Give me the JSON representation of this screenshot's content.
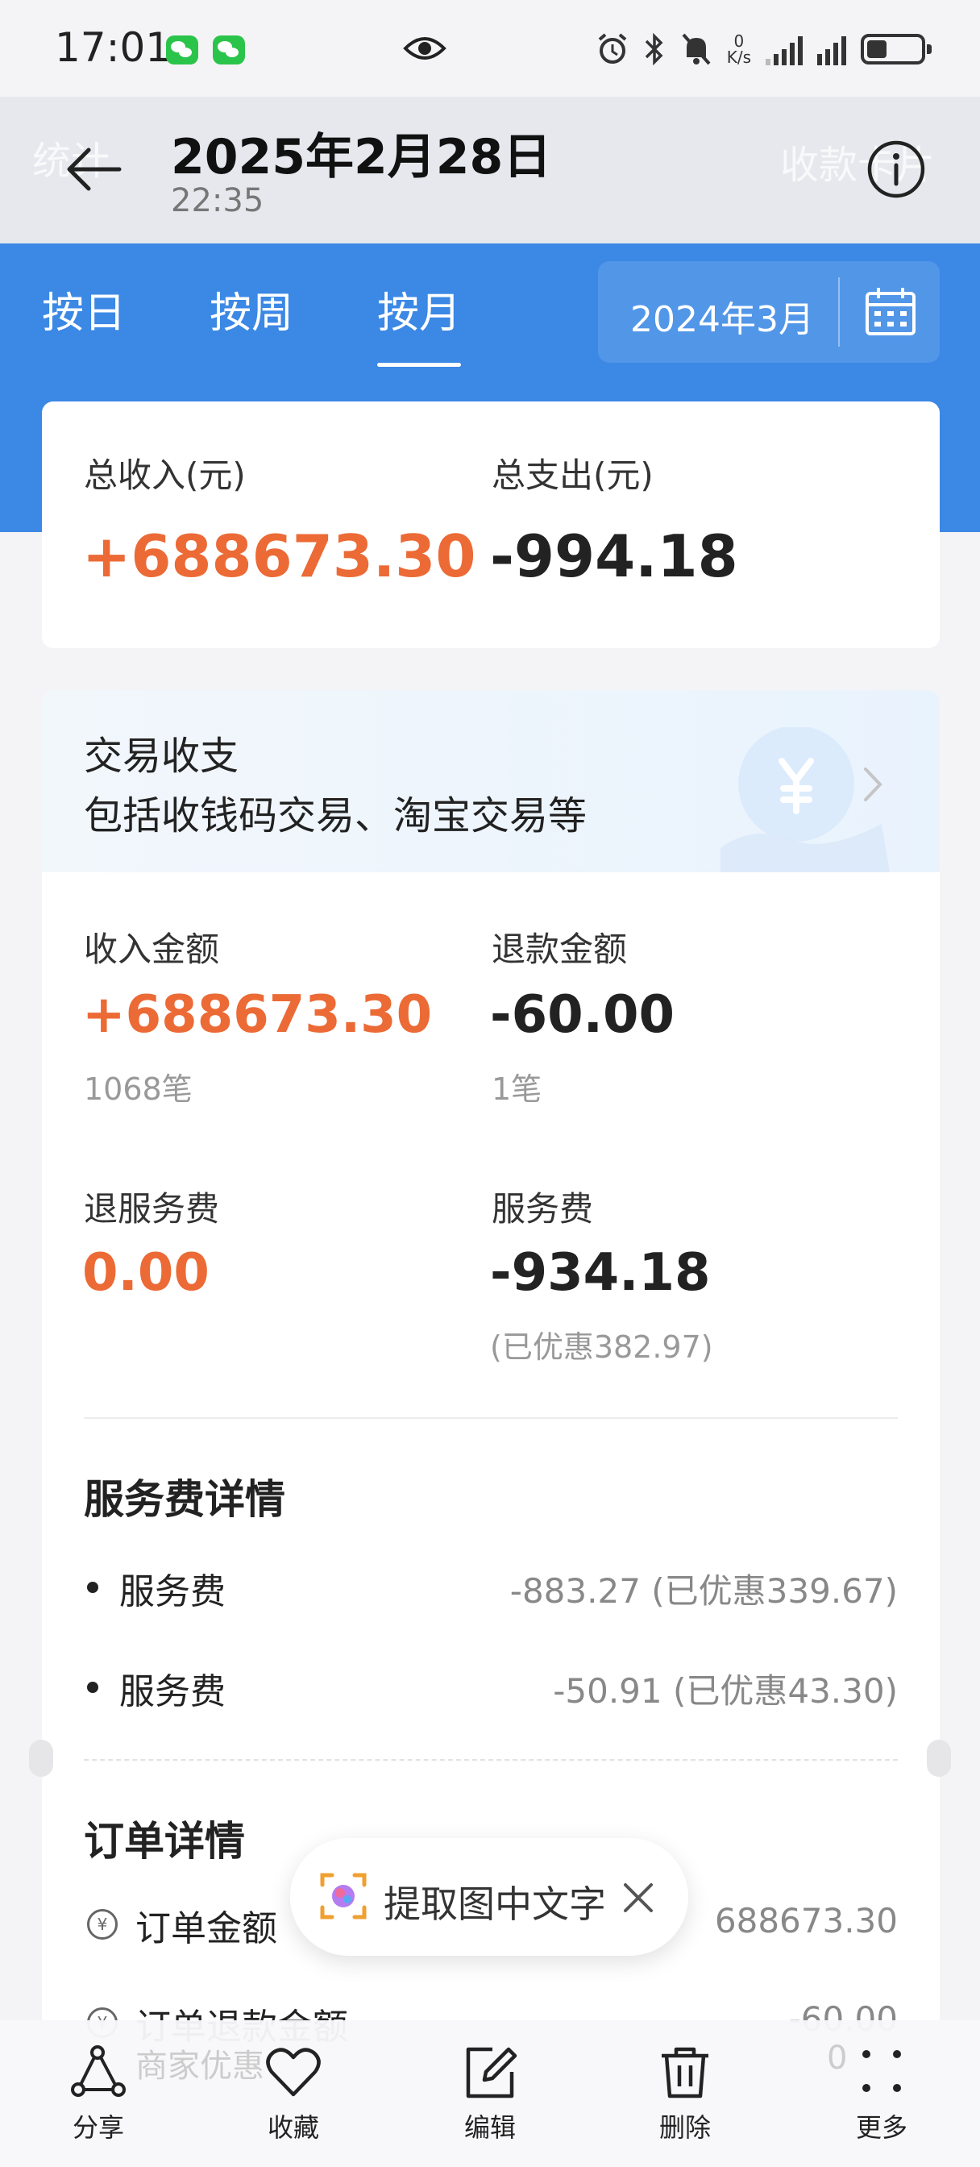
{
  "status_bar": {
    "time": "17:01",
    "net_speed_top": "0",
    "net_speed_bottom": "K/s"
  },
  "header": {
    "title": "2025年2月28日",
    "subtitle": "22:35",
    "ghost_left": "统计",
    "ghost_right": "收款卡片"
  },
  "tabs": [
    {
      "label": "按日",
      "active": false
    },
    {
      "label": "按周",
      "active": false
    },
    {
      "label": "按月",
      "active": true
    }
  ],
  "month_selector": {
    "value": "2024年3月"
  },
  "summary": {
    "income_label": "总收入(元)",
    "income_value": "+688673.30",
    "expense_label": "总支出(元)",
    "expense_value": "-994.18"
  },
  "transactions": {
    "title": "交易收支",
    "subtitle": "包括收钱码交易、淘宝交易等",
    "income_label": "收入金额",
    "income_value": "+688673.30",
    "income_count": "1068笔",
    "refund_label": "退款金额",
    "refund_value": "-60.00",
    "refund_count": "1笔",
    "fee_refund_label": "退服务费",
    "fee_refund_value": "0.00",
    "fee_label": "服务费",
    "fee_value": "-934.18",
    "fee_note": "(已优惠382.97)"
  },
  "fee_details": {
    "title": "服务费详情",
    "rows": [
      {
        "label": "服务费",
        "value": "-883.27 (已优惠339.67)"
      },
      {
        "label": "服务费",
        "value": "-50.91 (已优惠43.30)"
      }
    ]
  },
  "order_details": {
    "title": "订单详情",
    "rows": [
      {
        "label": "订单金额",
        "value": "688673.30"
      },
      {
        "label": "订单退款金额",
        "value": "-60.00"
      }
    ],
    "partial_row": {
      "label": "商家优惠",
      "value": "0"
    }
  },
  "ocr_popup": {
    "text": "提取图中文字"
  },
  "bottom_bar": [
    {
      "label": "分享",
      "icon": "share-icon"
    },
    {
      "label": "收藏",
      "icon": "heart-icon"
    },
    {
      "label": "编辑",
      "icon": "edit-icon"
    },
    {
      "label": "删除",
      "icon": "trash-icon"
    },
    {
      "label": "更多",
      "icon": "more-icon"
    }
  ],
  "colors": {
    "accent_blue": "#3b88e5",
    "income_orange": "#ec6a35",
    "text_dark": "#222222"
  }
}
